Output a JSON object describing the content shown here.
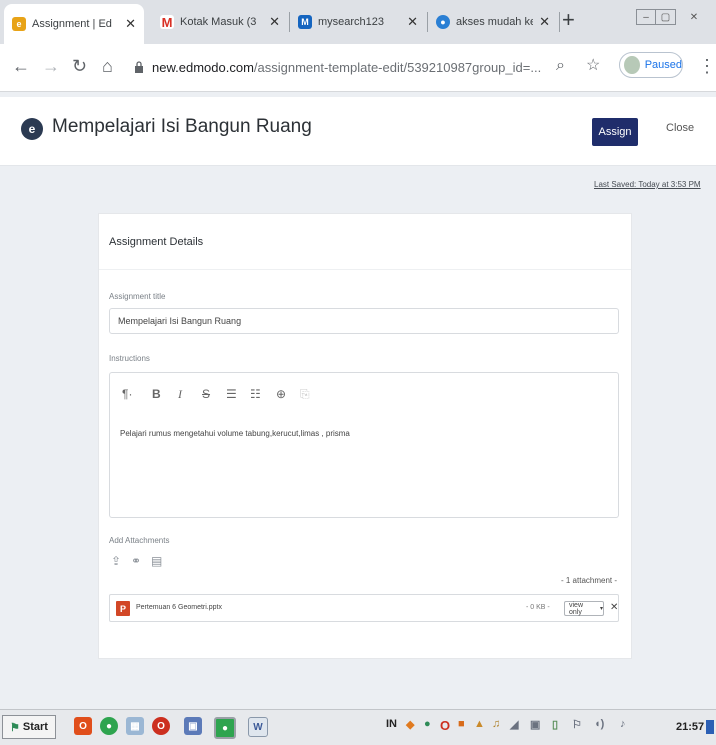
{
  "browser": {
    "tabs": [
      {
        "title": "Assignment | Ed",
        "favicon": "edmodo-icon",
        "color": "#e8a317",
        "active": true
      },
      {
        "title": "Kotak Masuk (3",
        "favicon": "gmail-icon",
        "color": "#d93025",
        "active": false
      },
      {
        "title": "mysearch123",
        "favicon": "mysearch-icon",
        "color": "#1565c0",
        "active": false
      },
      {
        "title": "akses mudah ke",
        "favicon": "globe-icon",
        "color": "#2a7fd4",
        "active": false
      }
    ],
    "new_tab_icon": "+",
    "url_host": "new.edmodo.com",
    "url_path": "/assignment-template-edit/539210987group_id=...",
    "profile_status": "Paused"
  },
  "app": {
    "logo_letter": "e",
    "title": "Mempelajari Isi Bangun Ruang",
    "assign_label": "Assign",
    "close_label": "Close",
    "last_saved": "Last Saved: Today at 3:53 PM",
    "accent": "#1f2d6b"
  },
  "form": {
    "section_title": "Assignment Details",
    "title_label": "Assignment title",
    "title_value": "Mempelajari Isi Bangun Ruang",
    "instructions_label": "Instructions",
    "editor_tools": [
      "¶·",
      "B",
      "I",
      "S",
      "☰",
      "☷",
      "⊕",
      "⎘"
    ],
    "instructions_text": "Pelajari rumus mengetahui volume tabung,kerucut,limas , prisma",
    "attachments_label": "Add Attachments",
    "attachment_count": "- 1 attachment -",
    "attachment": {
      "name": "Pertemuan 6 Geometri.pptx",
      "size": "- 0 KB -",
      "permission": "view only"
    }
  },
  "taskbar": {
    "start_label": "Start",
    "clock": "21:57"
  }
}
